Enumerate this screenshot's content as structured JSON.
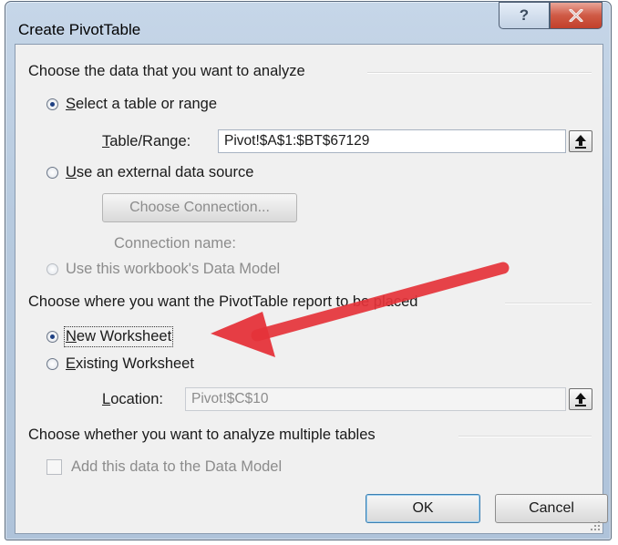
{
  "window": {
    "title": "Create PivotTable",
    "help_glyph": "?",
    "close_glyph": "X"
  },
  "data_group": {
    "heading": "Choose the data that you want to analyze",
    "select_range": {
      "accel": "S",
      "rest": "elect a table or range",
      "selected": true
    },
    "table_range": {
      "accel": "T",
      "rest": "able/Range:",
      "value": "Pivot!$A$1:$BT$67129"
    },
    "external_source": {
      "accel": "U",
      "rest": "se an external data source",
      "selected": false
    },
    "choose_connection_label": "Choose Connection...",
    "connection_name_label": "Connection name:",
    "data_model_option": {
      "label": "Use this workbook's Data Model",
      "enabled": false
    }
  },
  "placement_group": {
    "heading": "Choose where you want the PivotTable report to be placed",
    "new_worksheet": {
      "accel": "N",
      "rest": "ew Worksheet",
      "selected": true
    },
    "existing_worksheet": {
      "accel": "E",
      "rest": "xisting Worksheet",
      "selected": false
    },
    "location": {
      "accel": "L",
      "rest": "ocation:",
      "value": "Pivot!$C$10"
    }
  },
  "multi_group": {
    "heading": "Choose whether you want to analyze multiple tables",
    "add_to_model": {
      "label": "Add this data to the Data Model",
      "checked": false,
      "enabled": false
    }
  },
  "buttons": {
    "ok_label": "OK",
    "cancel_label": "Cancel"
  },
  "colors": {
    "annotation_arrow": "#e5333a",
    "radio_dot": "#1d3f82",
    "title_bar": "#b7cadf"
  },
  "icons": [
    "help-icon",
    "close-icon",
    "collapse-dialog-icon",
    "resize-grip-icon"
  ]
}
